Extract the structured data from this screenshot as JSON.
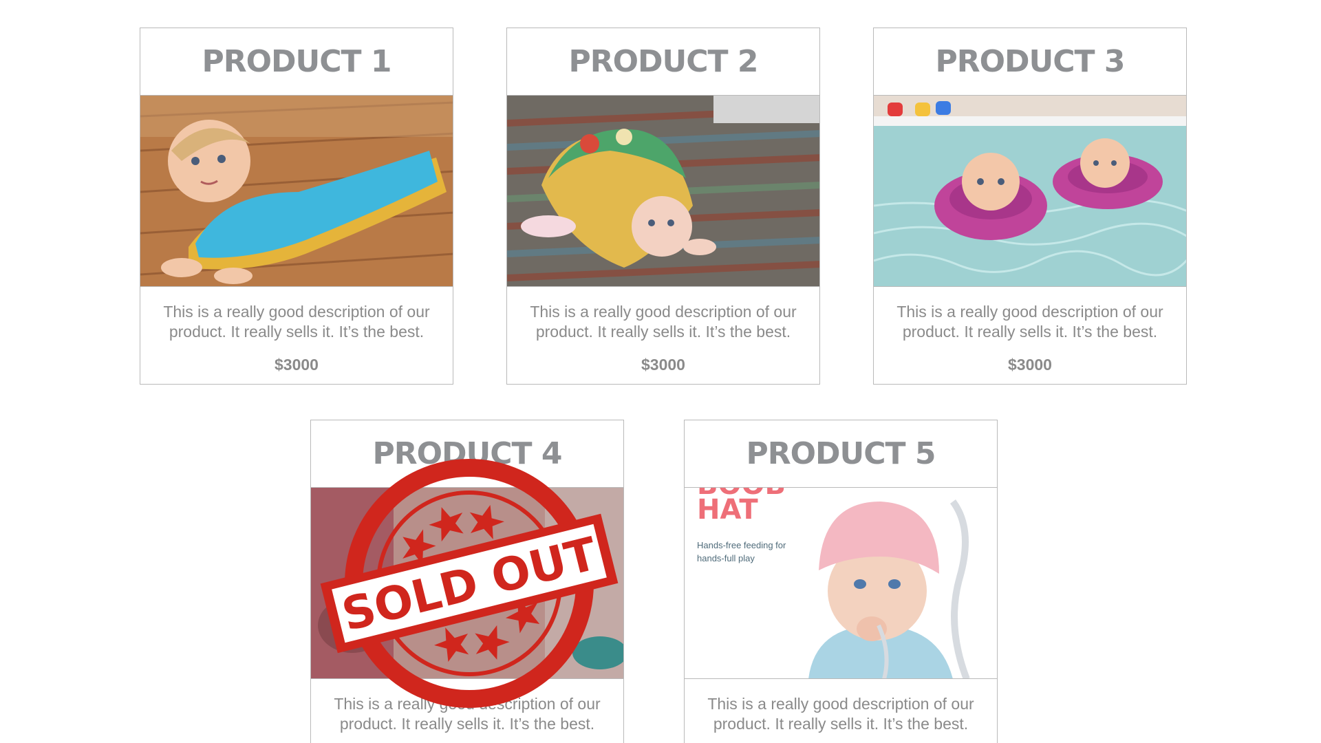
{
  "products": [
    {
      "title": "PRODUCT 1",
      "description": "This is a really good description of our product. It really sells it. It’s the best.",
      "price": "$3000"
    },
    {
      "title": "PRODUCT 2",
      "description": "This is a really good description of our product. It really sells it. It’s the best.",
      "price": "$3000"
    },
    {
      "title": "PRODUCT 3",
      "description": "This is a really good description of our product. It really sells it. It’s the best.",
      "price": "$3000"
    },
    {
      "title": "PRODUCT 4",
      "description": "This is a really good description of our product. It really sells it. It’s the best.",
      "sold_out": true
    },
    {
      "title": "PRODUCT 5",
      "description": "This is a really good description of our product. It really sells it. It’s the best.",
      "image_text": {
        "cut_title": "BOOB",
        "title": "HAT",
        "subtitle": "Hands-free feeding for hands-full play"
      }
    }
  ],
  "stamp": {
    "text": "SOLD OUT",
    "color": "#d0261d"
  },
  "colors": {
    "title": "#8e9093",
    "text": "#8a8a8a",
    "border": "#b9b9b9"
  }
}
